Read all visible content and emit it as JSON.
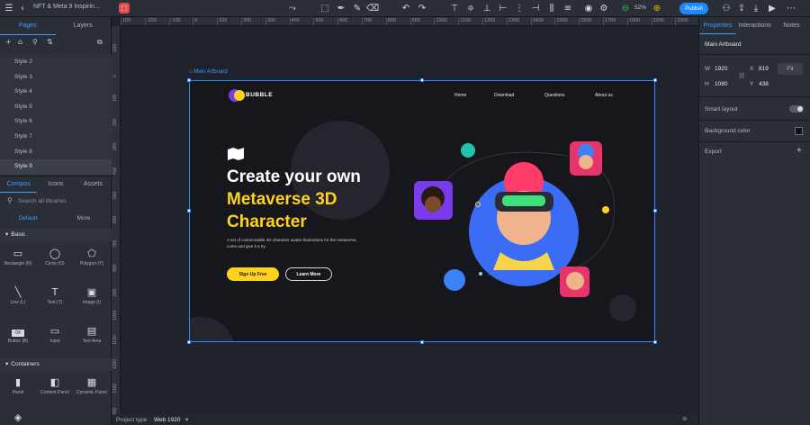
{
  "topbar": {
    "file_title": "NFT & Meta 9 Inspirin...",
    "zoom": "52%",
    "publish": "Publish"
  },
  "left": {
    "tabs": [
      "Pages",
      "Layers"
    ],
    "pages": [
      "Style 2",
      "Style 3",
      "Style 4",
      "Style 5",
      "Style 6",
      "Style 7",
      "Style 8",
      "Style 9"
    ],
    "lib_tabs": [
      "Compos",
      "Icons",
      "Assets"
    ],
    "search_placeholder": "Search all libraries",
    "sub_tabs": [
      "Default",
      "More"
    ],
    "basic_title": "Basic",
    "basic": [
      "Rectangle (R)",
      "Circle (O)",
      "Polygon (Y)",
      "Line (L)",
      "Text (T)",
      "Image (I)",
      "Button (B)",
      "Input",
      "Text Area"
    ],
    "containers_title": "Containers",
    "containers": [
      "Panel",
      "Content Panel",
      "Dynamic Panel"
    ],
    "button_icon_text": "OK"
  },
  "rulers": {
    "h": [
      "100",
      "-200",
      "-100",
      "0",
      "100",
      "200",
      "300",
      "400",
      "500",
      "600",
      "700",
      "800",
      "900",
      "1000",
      "1100",
      "1200",
      "1300",
      "1400",
      "1500",
      "1600",
      "1700",
      "1800",
      "1900",
      "2000"
    ],
    "v": [
      "-100",
      "0",
      "100",
      "200",
      "300",
      "400",
      "500",
      "600",
      "700",
      "800",
      "900",
      "1000",
      "1100",
      "1200",
      "1300",
      "1400"
    ]
  },
  "artboard": {
    "label": "Main Artboard",
    "brand": "BUBBLE",
    "nav": [
      "Home",
      "Download",
      "Questions",
      "About us"
    ],
    "headline1": "Create your own",
    "headline2": "Metaverse 3D",
    "headline3": "Character",
    "body": "A set of customizable 3D character avatar illustrations for the metaverse, come and give it a try.",
    "cta_primary": "Sign Up Free",
    "cta_secondary": "Learn More"
  },
  "bottom": {
    "project_type_label": "Project type",
    "project_type_value": "Web 1920"
  },
  "right": {
    "tabs": [
      "Properties",
      "Interactions",
      "Notes"
    ],
    "selection": "Main Artboard",
    "w_label": "W",
    "w": "1920",
    "h_label": "H",
    "h": "1080",
    "x_label": "X",
    "x": "819",
    "y_label": "Y",
    "y": "438",
    "fit": "Fit",
    "smart_layout": "Smart layout",
    "background_color": "Background color",
    "export": "Export"
  },
  "colors": {
    "accent": "#2b8cff",
    "yellow": "#ffd21e",
    "avatar_blue": "#3b6cf6"
  }
}
